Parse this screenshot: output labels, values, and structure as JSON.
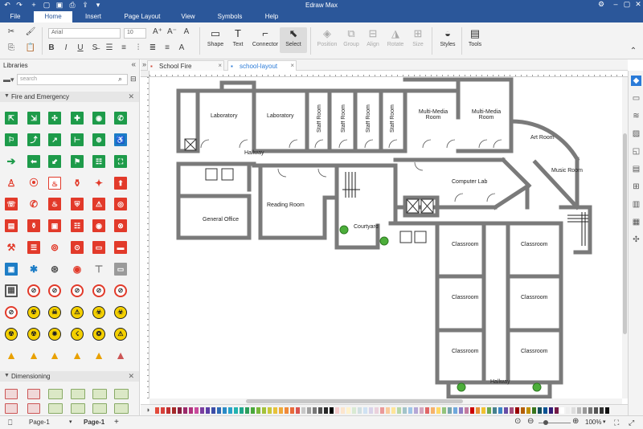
{
  "app": {
    "title": "Edraw Max",
    "quick_access": [
      "undo-icon",
      "redo-icon",
      "new-icon",
      "open-icon",
      "save-icon",
      "print-icon",
      "export-icon",
      "more-icon"
    ]
  },
  "menu": {
    "items": [
      {
        "label": "File"
      },
      {
        "label": "Home"
      },
      {
        "label": "Insert"
      },
      {
        "label": "Page Layout"
      },
      {
        "label": "View"
      },
      {
        "label": "Symbols"
      },
      {
        "label": "Help"
      }
    ],
    "active": "Home"
  },
  "ribbon": {
    "font_name": "Arial",
    "font_size": "10",
    "tools": [
      {
        "label": "Shape",
        "enabled": true
      },
      {
        "label": "Text",
        "enabled": true
      },
      {
        "label": "Connector",
        "enabled": true
      },
      {
        "label": "Select",
        "enabled": true
      },
      {
        "label": "Position",
        "enabled": false
      },
      {
        "label": "Group",
        "enabled": false
      },
      {
        "label": "Align",
        "enabled": false
      },
      {
        "label": "Rotate",
        "enabled": false
      },
      {
        "label": "Size",
        "enabled": false
      },
      {
        "label": "Styles",
        "enabled": true
      },
      {
        "label": "Tools",
        "enabled": true
      }
    ]
  },
  "library": {
    "title": "Libraries",
    "search_placeholder": "search",
    "sections": [
      {
        "label": "Fire and Emergency",
        "expanded": true
      },
      {
        "label": "Dimensioning",
        "expanded": true
      }
    ]
  },
  "tabs": [
    {
      "label": "School Fire Evacua...",
      "active": false
    },
    {
      "label": "school-layout",
      "active": true
    }
  ],
  "floorplan": {
    "rooms": [
      "Laboratory",
      "Laboratory",
      "Staff Room",
      "Staff Room",
      "Staff Room",
      "Staff Room",
      "Multi-Media Room",
      "Multi-Media Room",
      "Art Room",
      "Music Room",
      "Hallway",
      "Computer Lab",
      "General Office",
      "Reading Room",
      "Courtyard",
      "Classroom",
      "Classroom",
      "Classroom",
      "Classroom",
      "Classroom",
      "Classroom",
      "Hallway"
    ]
  },
  "status": {
    "page_selector": "Page-1",
    "page_tab": "Page-1",
    "zoom": "100%"
  },
  "colors": {
    "accent": "#2b579a",
    "wall": "#7a7a7a",
    "select_blue": "#2b7bd8"
  }
}
